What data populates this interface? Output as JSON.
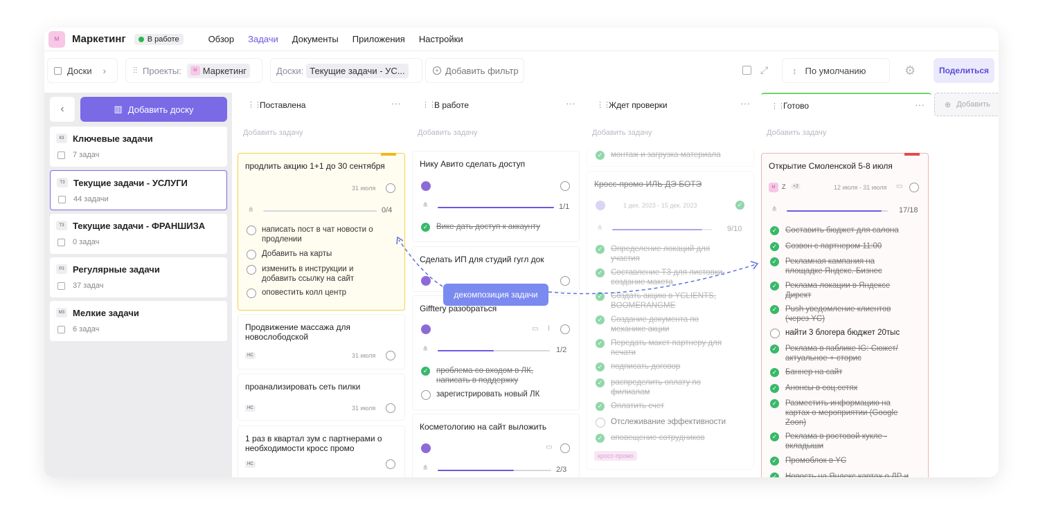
{
  "app": {
    "logo": "М",
    "title": "Маркетинг",
    "status": "В работе",
    "nav": [
      "Обзор",
      "Задачи",
      "Документы",
      "Приложения",
      "Настройки"
    ]
  },
  "toolbar": {
    "boards": "Доски",
    "projects_label": "Проекты:",
    "project": "Маркетинг",
    "boards_label": "Доски:",
    "board": "Текущие задачи - УС...",
    "add_filter": "Добавить фильтр",
    "sort": "По умолчанию",
    "share": "Поделиться",
    "project_badge": "М"
  },
  "sidebar": {
    "add": "Добавить доску",
    "items": [
      {
        "abbr": "КЗ",
        "name": "Ключевые задачи",
        "count": "7 задач"
      },
      {
        "abbr": "ТЗ",
        "name": "Текущие задачи - УСЛУГИ",
        "count": "44 задачи"
      },
      {
        "abbr": "ТЗ",
        "name": "Текущие задачи - ФРАНШИЗА",
        "count": "0 задач"
      },
      {
        "abbr": "РЗ",
        "name": "Регулярные задачи",
        "count": "37 задач"
      },
      {
        "abbr": "МЗ",
        "name": "Мелкие задачи",
        "count": "6 задач"
      }
    ]
  },
  "add_task": "Добавить задачу",
  "columns": [
    {
      "title": "Поставлена",
      "cards": [
        {
          "title": "продлить акцию 1+1 до 30 сентября",
          "date": "31 июля",
          "progress": "0/4",
          "subtasks": [
            "написать пост в чат новости о продлении",
            "Добавить на карты",
            "изменить в инструкции и добавить ссылку на сайт",
            "оповестить колл центр"
          ]
        },
        {
          "title": "Продвижение массажа для новослободской",
          "initials": "НС",
          "date": "31 июля"
        },
        {
          "title": "проанализировать сеть пилки",
          "initials": "НС",
          "date": "31 июля"
        },
        {
          "title": "1 раз в квартал зум с партнерами о необходимости кросс промо",
          "initials": "НС"
        }
      ]
    },
    {
      "title": "В работе",
      "cards": [
        {
          "title": "Нику Авито сделать доступ",
          "progress": "1/1",
          "subtasks": [
            "Вике дать доступ к аккаунту"
          ]
        },
        {
          "title": "Сделать ИП для студий гугл док"
        },
        {
          "title": "Gifftery разобраться",
          "progress": "1/2",
          "subtasks": [
            "проблема со входом в ЛК, написать в поддержку",
            "зарегистрировать новый ЛК"
          ]
        },
        {
          "title": "Косметологию на сайт выложить",
          "progress": "2/3"
        }
      ]
    },
    {
      "title": "Ждет проверки",
      "cards": [
        {
          "subtasks": [
            "монтаж и загрузка материала"
          ]
        },
        {
          "title": "Кросс-промо ИЛЬ ДЭ БОТЭ",
          "date": "1 дек. 2023 - 15 дек. 2023",
          "progress": "9/10",
          "subtasks": [
            "Определение локаций для участия",
            "Составление ТЗ для листовки, создание макета",
            "Создать акцию в YCLIENTS, BOOMERANGME",
            "Создание документа по механике акции",
            "Передать макет партнеру для печати",
            "подписать договор",
            "распределить оплату по филиалам",
            "Оплатить счет",
            "Отслеживание эффективности",
            "оповещение сотрудников"
          ],
          "tag": "кросс-промо"
        }
      ]
    },
    {
      "title": "Готово",
      "cards": [
        {
          "title": "Открытие Смоленской 5-8 июля",
          "date": "12 июля - 31 июля",
          "progress": "17/18",
          "avatars": [
            "М",
            "Z",
            "+2"
          ],
          "subtasks": [
            "Составить бюджет для салона",
            "Созвон с партнером 11:00",
            "Рекламная кампания на площадке Яндекс. Бизнес",
            "Реклама локации в Яндексе Директ",
            "Push уведомление клиентов (через YC)",
            "найти 3 блогера бюджет 20тыс",
            "Реклама в паблике IG: Сюжет/ актуальное + сторис",
            "Баннер на сайт",
            "Анонсы в соц.сетях",
            "Разместить информацию на картах о мероприятии (Google Zoon)",
            "Реклама в ростовой кукле - вкладыши",
            "Промоблок в YC",
            "Новость на Яндекс картах о ДР и"
          ]
        }
      ]
    }
  ],
  "add_column": "Добавить",
  "tooltip": "декомпозиция задачи"
}
